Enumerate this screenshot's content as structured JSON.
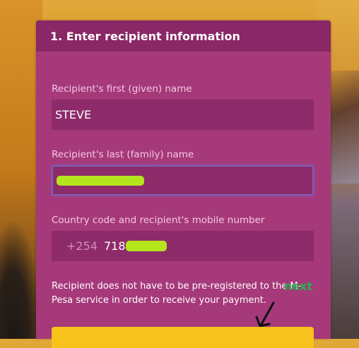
{
  "form": {
    "title": "1. Enter recipient information",
    "first_name_label": "Recipient's first (given) name",
    "first_name_value": "STEVE",
    "last_name_label": "Recipient's last (family) name",
    "phone_label": "Country code and recipient's mobile number",
    "phone_prefix": "+254",
    "phone_value_visible": "718",
    "info_text": "Recipient does not have to be pre-registered to the M-Pesa service in order to receive your payment.",
    "next_annotation": "next"
  },
  "colors": {
    "panel": "#a6397a",
    "header": "#8a2767",
    "field": "#8e2b6a",
    "redaction": "#b5e61d",
    "annotation": "#22b14c",
    "button": "#f7c21b"
  }
}
